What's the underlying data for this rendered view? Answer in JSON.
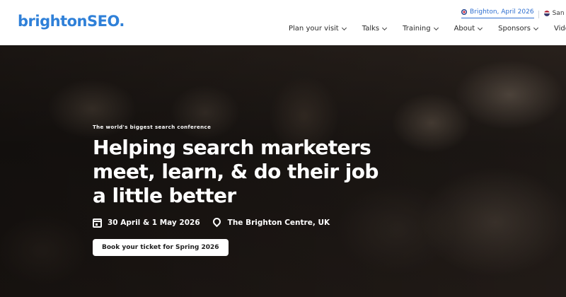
{
  "header": {
    "logo": "brightonSEO.",
    "events": [
      {
        "label": "Brighton, April 2026",
        "flag": "uk-flag-icon"
      },
      {
        "label": "San Diego",
        "flag": "us-flag-icon"
      }
    ],
    "nav": [
      {
        "label": "Plan your visit",
        "has_dropdown": true
      },
      {
        "label": "Talks",
        "has_dropdown": true
      },
      {
        "label": "Training",
        "has_dropdown": true
      },
      {
        "label": "About",
        "has_dropdown": true
      },
      {
        "label": "Sponsors",
        "has_dropdown": true
      },
      {
        "label": "Videos",
        "has_dropdown": false
      }
    ]
  },
  "hero": {
    "tagline": "The world's biggest search conference",
    "headline": "Helping search marketers meet, learn, & do their job a little better",
    "date": "30 April & 1 May 2026",
    "venue": "The Brighton Centre, UK",
    "cta_label": "Book your ticket for Spring 2026"
  },
  "colors": {
    "brand": "#2f80d8",
    "active_link": "#2f6fd0",
    "hero_text": "#ffffff"
  }
}
